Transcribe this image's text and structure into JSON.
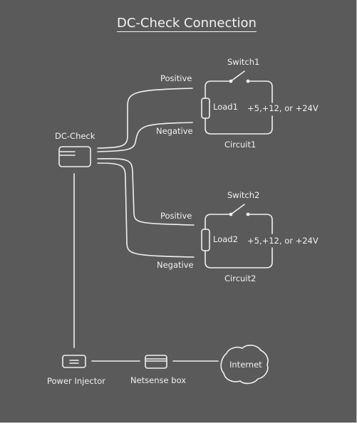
{
  "title": "DC-Check Connection",
  "colors": {
    "background": "#5a5a5a",
    "stroke": "#f0f0f0",
    "border": "#bdbdbd"
  },
  "nodes": {
    "dc_check": {
      "label": "DC-Check",
      "icon": "device-card-icon"
    },
    "power_injector": {
      "label": "Power Injector",
      "icon": "power-injector-icon"
    },
    "netsense_box": {
      "label": "Netsense box",
      "icon": "netsense-box-icon"
    },
    "internet": {
      "label": "Internet",
      "icon": "cloud-icon"
    }
  },
  "circuits": [
    {
      "name": "Circuit1",
      "switch": "Switch1",
      "load": "Load1",
      "voltage": "+5,+12, or +24V",
      "positive": "Positive",
      "negative": "Negative"
    },
    {
      "name": "Circuit2",
      "switch": "Switch2",
      "load": "Load2",
      "voltage": "+5,+12, or +24V",
      "positive": "Positive",
      "negative": "Negative"
    }
  ]
}
